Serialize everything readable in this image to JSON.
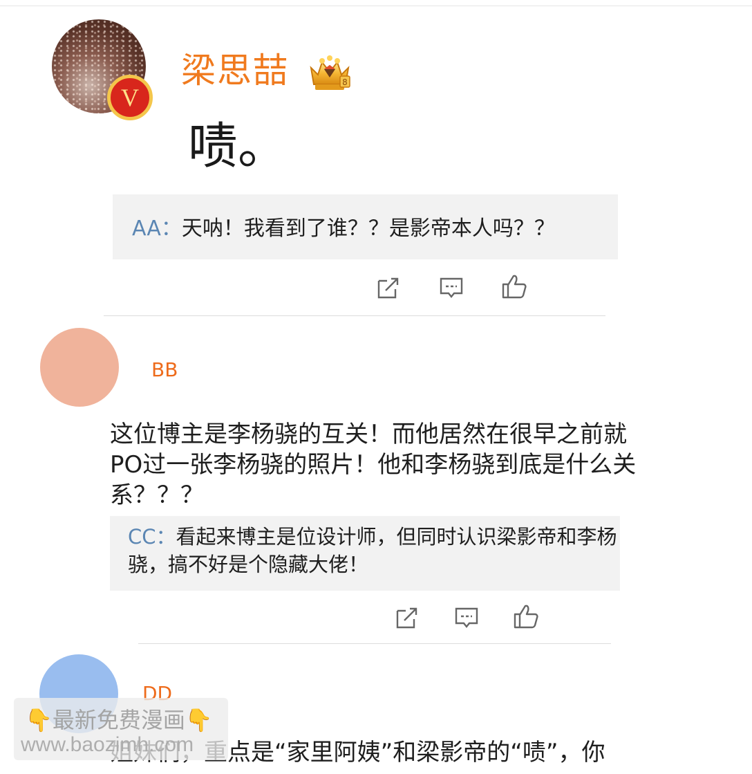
{
  "post1": {
    "username": "梁思喆",
    "verified_badge": "V",
    "badge_icon": "crown-diamond-icon",
    "text": "啧。",
    "quote": {
      "name": "AA",
      "separator": "：",
      "text": "天呐！我看到了谁？？是影帝本人吗？？"
    },
    "actions": [
      "share-icon",
      "comment-icon",
      "like-icon"
    ]
  },
  "post2": {
    "username": "BB",
    "avatar_color": "#f0b39b",
    "text": "这位博主是李杨骁的互关！而他居然在很早之前就PO过一张李杨骁的照片！他和李杨骁到底是什么关系？？？",
    "quote": {
      "name": "CC",
      "separator": "：",
      "text": "看起来博主是位设计师，但同时认识梁影帝和李杨骁，搞不好是个隐藏大佬！"
    },
    "actions": [
      "share-icon",
      "comment-icon",
      "like-icon"
    ]
  },
  "post3": {
    "username": "DD",
    "avatar_color": "#99bdef",
    "text": "姐妹们，重点是“家里阿姨”和梁影帝的“啧”，你"
  },
  "watermark": {
    "line1": "👇最新免费漫画👇",
    "line2": "www.baozimh.com"
  },
  "colors": {
    "username_orange": "#f07a1e",
    "quote_name_blue": "#5b86b3",
    "quote_bg": "#f2f2f2"
  }
}
